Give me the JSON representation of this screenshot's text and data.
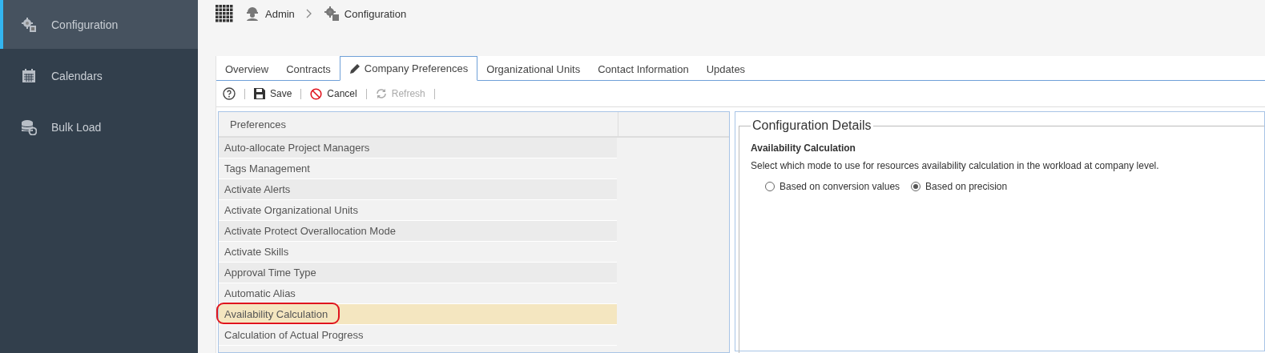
{
  "sidebar": {
    "items": [
      {
        "label": "Configuration",
        "selected": true
      },
      {
        "label": "Calendars",
        "selected": false
      },
      {
        "label": "Bulk Load",
        "selected": false
      }
    ]
  },
  "breadcrumb": [
    {
      "label": "Admin"
    },
    {
      "label": "Configuration"
    }
  ],
  "tabs": [
    {
      "label": "Overview",
      "selected": false
    },
    {
      "label": "Contracts",
      "selected": false
    },
    {
      "label": "Company Preferences",
      "selected": true
    },
    {
      "label": "Organizational Units",
      "selected": false
    },
    {
      "label": "Contact Information",
      "selected": false
    },
    {
      "label": "Updates",
      "selected": false
    }
  ],
  "toolbar": [
    {
      "kind": "help"
    },
    {
      "kind": "save",
      "label": "Save",
      "disabled": false
    },
    {
      "kind": "cancel",
      "label": "Cancel",
      "disabled": false
    },
    {
      "kind": "refresh",
      "label": "Refresh",
      "disabled": true
    }
  ],
  "preferences": {
    "column": "Preferences",
    "rows": [
      {
        "label": "Auto-allocate Project Managers",
        "selected": false,
        "annotated": false
      },
      {
        "label": "Tags Management",
        "selected": false,
        "annotated": false
      },
      {
        "label": "Activate Alerts",
        "selected": false,
        "annotated": false
      },
      {
        "label": "Activate Organizational Units",
        "selected": false,
        "annotated": false
      },
      {
        "label": "Activate Protect Overallocation Mode",
        "selected": false,
        "annotated": false
      },
      {
        "label": "Activate Skills",
        "selected": false,
        "annotated": false
      },
      {
        "label": "Approval Time Type",
        "selected": false,
        "annotated": false
      },
      {
        "label": "Automatic Alias",
        "selected": false,
        "annotated": false
      },
      {
        "label": "Availability Calculation",
        "selected": true,
        "annotated": true
      },
      {
        "label": "Calculation of Actual Progress",
        "selected": false,
        "annotated": false
      }
    ]
  },
  "details": {
    "legend": "Configuration Details",
    "heading": "Availability Calculation",
    "description": "Select which mode to use for resources availability calculation in the workload at company level.",
    "options": [
      {
        "label": "Based on conversion values",
        "selected": false
      },
      {
        "label": "Based on precision",
        "selected": true
      }
    ]
  }
}
